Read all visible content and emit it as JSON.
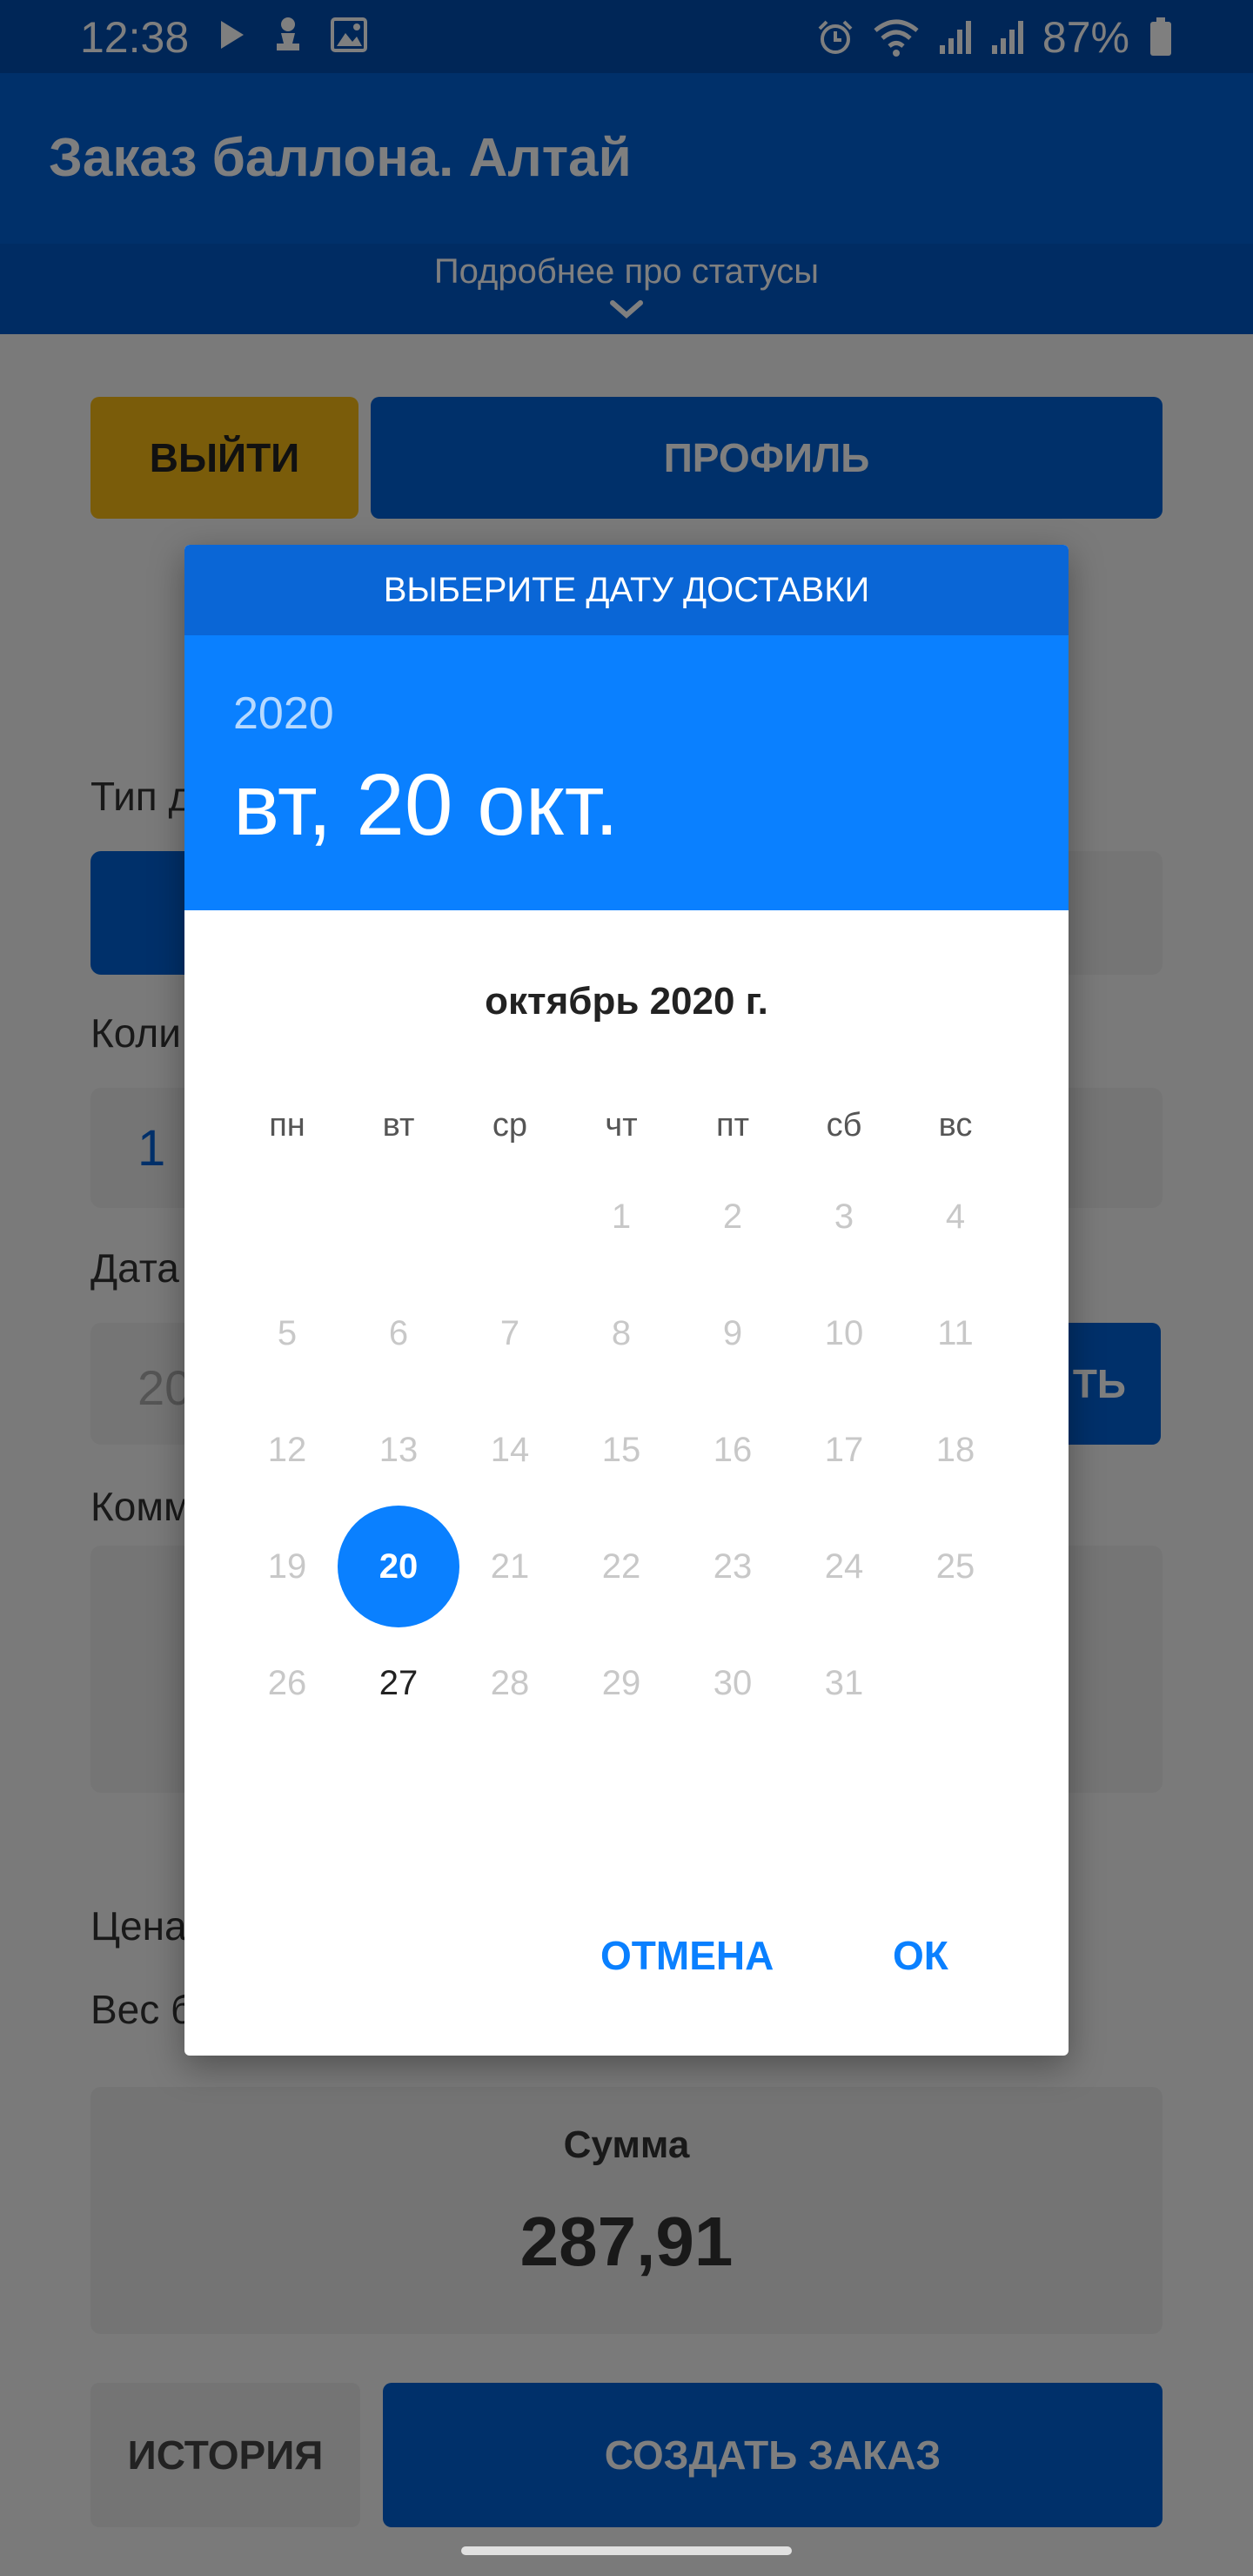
{
  "status_bar": {
    "time": "12:38",
    "battery": "87%",
    "left_icons": [
      "play-icon",
      "chess-pawn-icon",
      "image-icon"
    ],
    "right_icons": [
      "alarm-icon",
      "wifi-icon",
      "signal-icon",
      "signal-icon",
      "battery-icon"
    ]
  },
  "app": {
    "title": "Заказ баллона. Алтай"
  },
  "status_strip": {
    "text": "Подробнее про статусы"
  },
  "buttons": {
    "exit": "ВЫЙТИ",
    "profile": "ПРОФИЛЬ",
    "date_action": "ТЬ",
    "history": "ИСТОРИЯ",
    "create_order": "СОЗДАТЬ ЗАКАЗ"
  },
  "form": {
    "type_label": "Тип д",
    "quantity_label": "Коли",
    "quantity_value": "1",
    "date_label": "Дата",
    "date_value": "20",
    "comment_label": "Комм",
    "price_label": "Цена",
    "weight_label": "Вес б"
  },
  "sum": {
    "label": "Сумма",
    "value": "287,91"
  },
  "dialog": {
    "title": "ВЫБЕРИТЕ ДАТУ ДОСТАВКИ",
    "year": "2020",
    "selected_date": "вт, 20 окт.",
    "month": "октябрь 2020 г.",
    "weekdays": [
      "пн",
      "вт",
      "ср",
      "чт",
      "пт",
      "сб",
      "вс"
    ],
    "days": [
      "1",
      "2",
      "3",
      "4",
      "5",
      "6",
      "7",
      "8",
      "9",
      "10",
      "11",
      "12",
      "13",
      "14",
      "15",
      "16",
      "17",
      "18",
      "19",
      "20",
      "21",
      "22",
      "23",
      "24",
      "25",
      "26",
      "27",
      "28",
      "29",
      "30",
      "31"
    ],
    "selected_day": "20",
    "enabled_days": [
      "27"
    ],
    "cancel": "ОТМЕНА",
    "ok": "ОК"
  },
  "colors": {
    "primary": "#0060d4",
    "accent": "#0a80ff",
    "exit_button": "#f5b915"
  }
}
